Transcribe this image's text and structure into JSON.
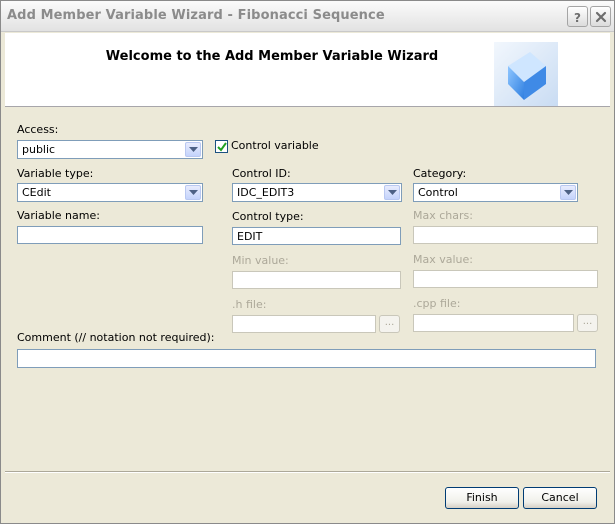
{
  "window": {
    "title": "Add Member Variable Wizard - Fibonacci Sequence",
    "help_label": "?",
    "close_label": "x"
  },
  "header": {
    "title": "Welcome to the Add Member Variable Wizard",
    "logo_icon": "blue-cube-icon"
  },
  "form": {
    "access": {
      "label": "Access:",
      "value": "public"
    },
    "control_variable": {
      "label": "Control variable",
      "checked": true
    },
    "variable_type": {
      "label": "Variable type:",
      "value": "CEdit"
    },
    "control_id": {
      "label": "Control ID:",
      "value": "IDC_EDIT3"
    },
    "category": {
      "label": "Category:",
      "value": "Control"
    },
    "variable_name": {
      "label": "Variable name:",
      "value": ""
    },
    "control_type": {
      "label": "Control type:",
      "value": "EDIT"
    },
    "max_chars": {
      "label": "Max chars:",
      "value": ""
    },
    "min_value": {
      "label": "Min value:",
      "value": ""
    },
    "max_value": {
      "label": "Max value:",
      "value": ""
    },
    "h_file": {
      "label": ".h file:",
      "value": "",
      "browse_label": "..."
    },
    "cpp_file": {
      "label": ".cpp file:",
      "value": "",
      "browse_label": "..."
    },
    "comment": {
      "label": "Comment (// notation not required):",
      "value": ""
    }
  },
  "footer": {
    "finish_label": "Finish",
    "cancel_label": "Cancel"
  },
  "colors": {
    "accent": "#003c74",
    "disabled_text": "#aca899",
    "field_border": "#7f9db9"
  }
}
